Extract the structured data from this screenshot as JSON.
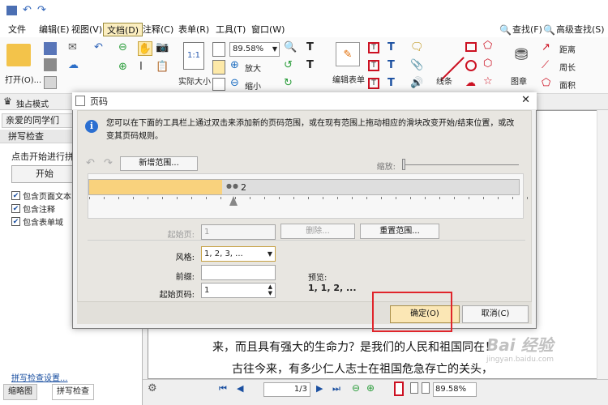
{
  "menu": {
    "items": [
      "文件",
      "编辑(E)",
      "视图(V)",
      "文档(D)",
      "注释(C)",
      "表单(R)",
      "工具(T)",
      "窗口(W)"
    ],
    "find_label": "查找(F)",
    "adv_find_label": "高级查找(S)"
  },
  "ribbon": {
    "open_label": "打开(O)...",
    "actual_size_label": "实际大小",
    "zoom_value": "89.58%",
    "zoom_in_label": "放大",
    "zoom_out_label": "缩小",
    "edit_form_label": "编辑表单",
    "lines_label": "线条",
    "stamp_label": "图章",
    "distance_label": "距离",
    "perimeter_label": "周长",
    "area_label": "面积",
    "actual_size_icon": "1:1"
  },
  "strip2": {
    "exclusive_mode_label": "独占模式"
  },
  "left_panel": {
    "tab_label": "亲爱的同学们",
    "title": "拼写检查",
    "hint": "点击开始进行拼",
    "start_button": "开始",
    "checks": [
      {
        "label": "包含页面文本",
        "checked": true
      },
      {
        "label": "包含注释",
        "checked": true
      },
      {
        "label": "包含表单域",
        "checked": true
      }
    ],
    "settings_link": "拼写检查设置...",
    "bottom_tabs": [
      "缩略图",
      "拼写检查"
    ]
  },
  "document": {
    "lines": [
      "来，而且具有强大的生命力？是我们的人民和祖国同在！",
      "古往今来，有多少仁人志士在祖国危急存亡的关头，"
    ]
  },
  "statusbar": {
    "page_value": "1/3",
    "zoom_value": "89.58%"
  },
  "dialog": {
    "title": "页码",
    "info": "您可以在下面的工具栏上通过双击来添加新的页码范围，或在现有范围上拖动相应的滑块改变开始/结束位置，或改变其页码规则。",
    "new_range_button": "新增范围...",
    "zoom_label": "缩放:",
    "range_marker": "2",
    "range_fraction": 0.31,
    "start_page_label": "起始页:",
    "start_page_value": "1",
    "delete_button": "删除...",
    "reset_button": "重置范围...",
    "style_label": "风格:",
    "style_value": "1, 2, 3, ...",
    "prefix_label": "前缀:",
    "prefix_value": "",
    "start_number_label": "起始页码:",
    "start_number_value": "1",
    "preview_label": "预览:",
    "preview_value": "1, 1, 2, ...",
    "ok_button": "确定(O)",
    "cancel_button": "取消(C)",
    "close_glyph": "✕"
  },
  "watermark": {
    "text": "Bai 经验",
    "sub": "jingyan.baidu.com"
  },
  "colors": {
    "accent": "#fbe7b5",
    "range_fill": "#f9d27d",
    "highlight_border": "#e0252b",
    "info_blue": "#2b6fd1"
  }
}
